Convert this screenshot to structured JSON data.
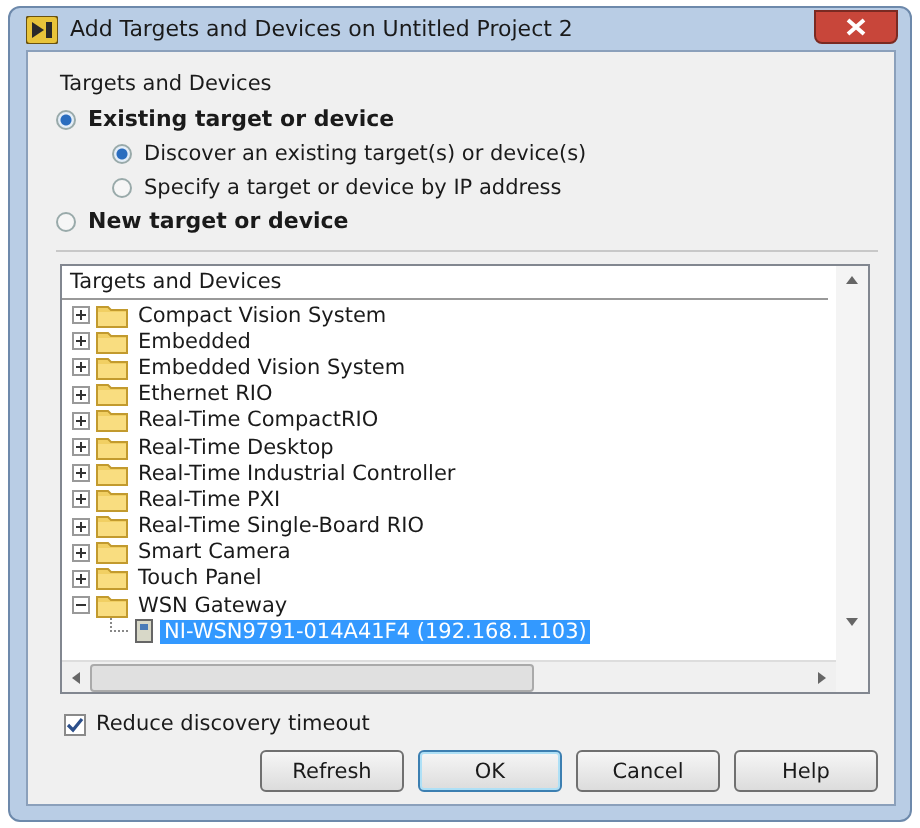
{
  "window": {
    "title": "Add Targets and Devices on Untitled Project 2"
  },
  "group_label": "Targets and Devices",
  "radio_options": [
    {
      "label": "Existing target or device",
      "selected": true,
      "children": [
        {
          "label": "Discover an existing target(s) or device(s)",
          "selected": true
        },
        {
          "label": "Specify a target or device by IP address",
          "selected": false
        }
      ]
    },
    {
      "label": "New target or device",
      "selected": false
    }
  ],
  "tree": {
    "header": "Targets and Devices",
    "items": [
      {
        "label": "Compact Vision System",
        "expanded": false,
        "selected": false
      },
      {
        "label": "Embedded",
        "expanded": false,
        "selected": false
      },
      {
        "label": "Embedded Vision System",
        "expanded": false,
        "selected": false
      },
      {
        "label": "Ethernet RIO",
        "expanded": false,
        "selected": false
      },
      {
        "label": "Real-Time CompactRIO",
        "expanded": false,
        "selected": false
      },
      {
        "label": "Real-Time Desktop",
        "expanded": false,
        "selected": false
      },
      {
        "label": "Real-Time Industrial Controller",
        "expanded": false,
        "selected": false
      },
      {
        "label": "Real-Time PXI",
        "expanded": false,
        "selected": false
      },
      {
        "label": "Real-Time Single-Board RIO",
        "expanded": false,
        "selected": false
      },
      {
        "label": "Smart Camera",
        "expanded": false,
        "selected": false
      },
      {
        "label": "Touch Panel",
        "expanded": false,
        "selected": false
      },
      {
        "label": "WSN Gateway",
        "expanded": true,
        "selected": false,
        "children": [
          {
            "label": "NI-WSN9791-014A41F4 (192.168.1.103)",
            "selected": true
          }
        ]
      }
    ]
  },
  "checkbox": {
    "label": "Reduce discovery timeout",
    "checked": true
  },
  "buttons": [
    {
      "label": "Refresh",
      "default": false
    },
    {
      "label": "OK",
      "default": true
    },
    {
      "label": "Cancel",
      "default": false
    },
    {
      "label": "Help",
      "default": false
    }
  ]
}
